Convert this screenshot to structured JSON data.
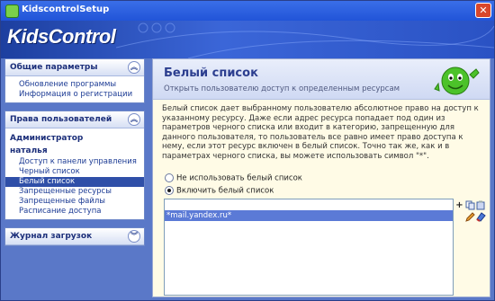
{
  "window": {
    "title": "KidscontrolSetup",
    "close_glyph": "✕"
  },
  "banner": {
    "logo": "KidsControl"
  },
  "sidebar": {
    "general": {
      "title": "Общие параметры",
      "items": [
        "Обновление программы",
        "Информация о регистрации"
      ]
    },
    "rights": {
      "title": "Права пользователей",
      "users": [
        "Администратор",
        "наталья"
      ],
      "items": [
        "Доступ к панели управления",
        "Черный список",
        "Белый список",
        "Запрещенные ресурсы",
        "Запрещенные файлы",
        "Расписание доступа"
      ],
      "selected_index": 2
    },
    "log": {
      "title": "Журнал загрузок"
    }
  },
  "main": {
    "title": "Белый список",
    "subtitle": "Открыть пользователю доступ к определенным ресурсам",
    "description": "Белый список дает выбранному пользователю абсолютное право на доступ к указанному ресурсу. Даже если адрес ресурса попадает под один из параметров черного списка или входит в категорию, запрещенную для данного пользователя, то пользователь все равно имеет право доступа к нему, если этот ресурс включен в белый список. Точно так же, как и в параметрах черного списка, вы можете использовать символ \"*\".",
    "radio_off": "Не использовать белый список",
    "radio_on": "Включить белый список",
    "list": [
      "*mail.yandex.ru*"
    ],
    "add_glyph": "+"
  },
  "colors": {
    "accent": "#2f4fa8",
    "selection": "#5b7ad6"
  }
}
